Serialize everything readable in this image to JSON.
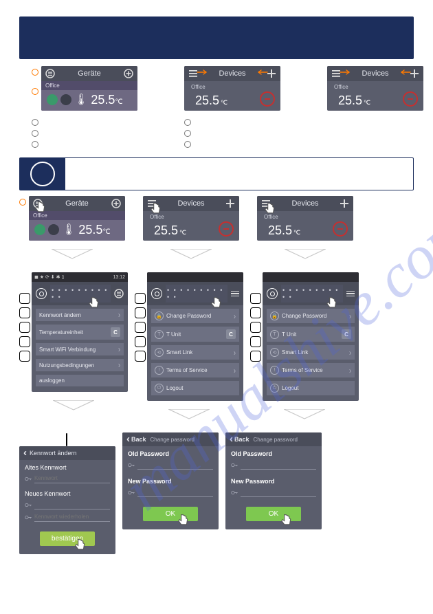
{
  "watermark": "manualshive.com",
  "top_tiles": {
    "german": {
      "title": "Geräte",
      "room": "Office",
      "temp": "25.5",
      "unit": "℃"
    },
    "english": {
      "title": "Devices",
      "room": "Office",
      "temp": "25.5",
      "unit": "℃"
    }
  },
  "step_tiles": {
    "german": {
      "title": "Geräte",
      "room": "Office",
      "temp": "25.5",
      "unit": "℃"
    },
    "english": {
      "title": "Devices",
      "room": "Office",
      "temp": "25.5",
      "unit": "℃"
    }
  },
  "menu": {
    "dots": "• • • • • • • • • • •",
    "german": {
      "status_time": "13:12",
      "items": [
        {
          "icon": "",
          "label": "Kennwort ändern",
          "tail": "chev"
        },
        {
          "icon": "",
          "label": "Temperatureinheit",
          "tail": "C"
        },
        {
          "icon": "",
          "label": "Smart WiFi Verbindung",
          "tail": "chev"
        },
        {
          "icon": "",
          "label": "Nutzungsbedingungen",
          "tail": "chev"
        },
        {
          "icon": "",
          "label": "ausloggen",
          "tail": ""
        }
      ]
    },
    "english": {
      "items": [
        {
          "icon": "🔒",
          "label": "Change Password",
          "tail": "chev"
        },
        {
          "icon": "T",
          "label": "T Unit",
          "tail": "C"
        },
        {
          "icon": "⟲",
          "label": "Smart Link",
          "tail": "chev"
        },
        {
          "icon": "!",
          "label": "Terms of Service",
          "tail": "chev"
        },
        {
          "icon": "⏻",
          "label": "Logout",
          "tail": ""
        }
      ]
    }
  },
  "pwd": {
    "german": {
      "title": "Kennwort ändern",
      "old_label": "Altes Kennwort",
      "old_placeholder": "Kennwort",
      "new_label": "Neues Kennwort",
      "new_placeholder": "Kennwort wiederholen",
      "confirm": "bestätigen"
    },
    "english": {
      "back": "Back",
      "title": "Change password",
      "old_label": "Old Password",
      "new_label": "New Password",
      "confirm": "OK"
    }
  }
}
